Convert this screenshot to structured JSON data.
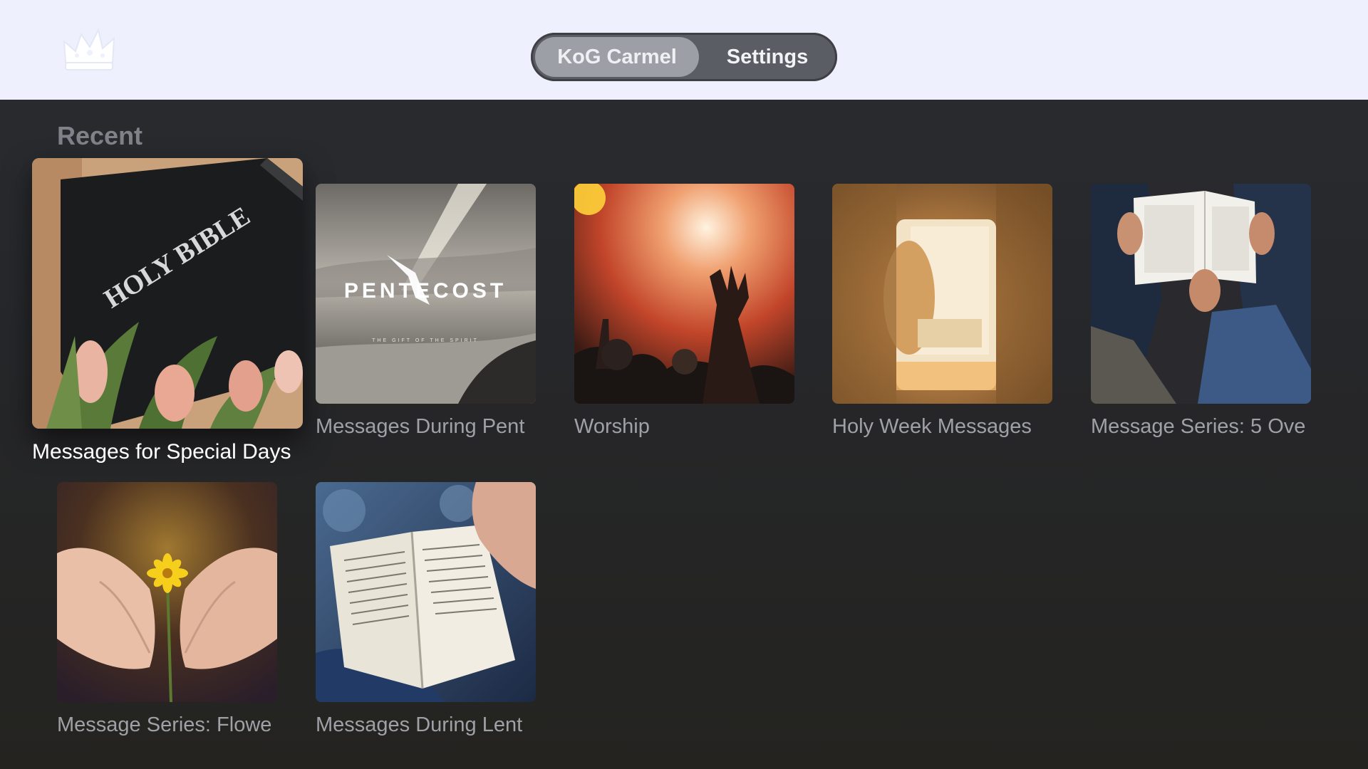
{
  "app": {
    "logo_icon": "crown-icon"
  },
  "nav": {
    "tabs": [
      {
        "label": "KoG Carmel",
        "selected": true
      },
      {
        "label": "Settings",
        "selected": false
      }
    ]
  },
  "section": {
    "title": "Recent"
  },
  "items": [
    {
      "title": "Messages for Special Days",
      "art": "holy-bible-tulips",
      "image_text": "HOLY BIBLE",
      "focused": true
    },
    {
      "title": "Messages During Pent",
      "art": "pentecost-dove",
      "image_text": "PENTECOST",
      "image_subtext": "THE GIFT OF THE SPIRIT"
    },
    {
      "title": "Worship",
      "art": "worship-hands"
    },
    {
      "title": "Holy Week Messages",
      "art": "empty-tomb"
    },
    {
      "title": "Message Series: 5 Ove",
      "art": "reading-bible-lap"
    },
    {
      "title": "Message Series: Flowe",
      "art": "hands-yellow-flower"
    },
    {
      "title": "Messages During Lent",
      "art": "open-bible-hand"
    }
  ],
  "colors": {
    "topbar": "#eef1fd",
    "background": "#26272a",
    "caption": "#9fa1a6",
    "section_title": "#7f8289"
  }
}
